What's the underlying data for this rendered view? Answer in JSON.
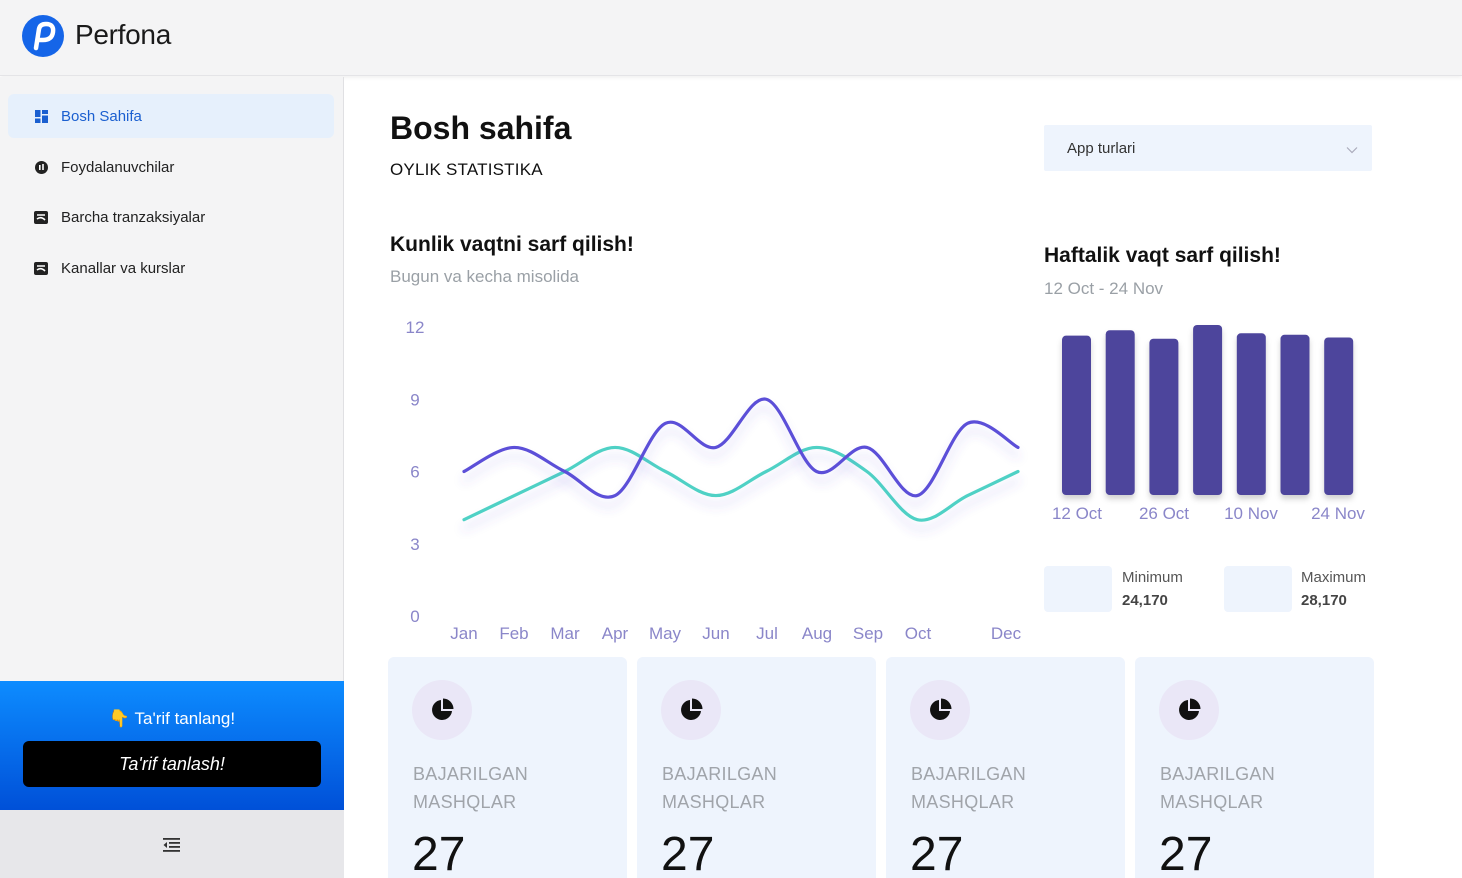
{
  "brand": {
    "name": "Perfona",
    "color": "#1565e8"
  },
  "sidebar": {
    "items": [
      {
        "label": "Bosh Sahifa",
        "icon": "dashboard-icon",
        "active": true
      },
      {
        "label": "Foydalanuvchilar",
        "icon": "users-icon",
        "active": false
      },
      {
        "label": "Barcha tranzaksiyalar",
        "icon": "transactions-icon",
        "active": false
      },
      {
        "label": "Kanallar va kurslar",
        "icon": "channels-icon",
        "active": false
      }
    ],
    "promo": {
      "title": "👇 Ta'rif tanlang!",
      "button": "Ta'rif tanlash!"
    },
    "collapse_icon": "collapse-menu-icon"
  },
  "header": {
    "title": "Bosh sahifa",
    "subtitle": "OYLIK STATISTIKA",
    "select": {
      "value": "App turlari"
    }
  },
  "daily_card": {
    "title": "Kunlik vaqtni sarf qilish!",
    "subtitle": "Bugun va kecha misolida"
  },
  "weekly_card": {
    "title": "Haftalik vaqt sarf qilish!",
    "subtitle": "12 Oct - 24 Nov",
    "min_label": "Minimum",
    "min_value": "24,170",
    "max_label": "Maximum",
    "max_value": "28,170"
  },
  "stats": [
    {
      "label_line1": "BAJARILGAN",
      "label_line2": "MASHQLAR",
      "value": "27",
      "icon": "pie-chart-icon"
    },
    {
      "label_line1": "BAJARILGAN",
      "label_line2": "MASHQLAR",
      "value": "27",
      "icon": "pie-chart-icon"
    },
    {
      "label_line1": "BAJARILGAN",
      "label_line2": "MASHQLAR",
      "value": "27",
      "icon": "pie-chart-icon"
    },
    {
      "label_line1": "BAJARILGAN",
      "label_line2": "MASHQLAR",
      "value": "27",
      "icon": "pie-chart-icon"
    }
  ],
  "chart_data": [
    {
      "type": "line",
      "title": "Kunlik vaqtni sarf qilish!",
      "categories": [
        "Jan",
        "Feb",
        "Mar",
        "Apr",
        "May",
        "Jun",
        "Jul",
        "Aug",
        "Sep",
        "Oct",
        "Dec"
      ],
      "series": [
        {
          "values": [
            6,
            7,
            6,
            5,
            8,
            7,
            9,
            6,
            7,
            5,
            8,
            7
          ],
          "color": "#5b4fd8"
        },
        {
          "values": [
            4,
            5,
            6,
            7,
            6,
            5,
            6,
            7,
            6,
            4,
            5,
            6
          ],
          "color": "#4fd1c5"
        }
      ],
      "yticks": [
        0,
        3,
        6,
        9,
        12
      ],
      "ylim": [
        0,
        12
      ],
      "grid": false
    },
    {
      "type": "bar",
      "title": "Haftalik vaqt sarf qilish!",
      "categories": [
        "12 Oct",
        "26 Oct",
        "10 Nov",
        "24 Nov"
      ],
      "values": [
        26400,
        27300,
        25900,
        28170,
        26800,
        26550,
        26100
      ],
      "ylim": [
        0,
        28170
      ],
      "color": "#4d449c",
      "grid": false
    }
  ]
}
